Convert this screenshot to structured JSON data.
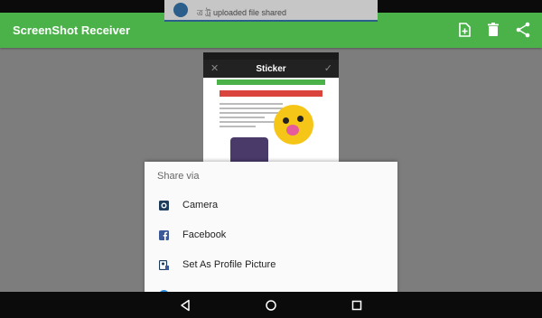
{
  "notification": {
    "text": "ত্র ট্র uploaded file shared"
  },
  "appbar": {
    "title": "ScreenShot Receiver",
    "actions": [
      "add-file-icon",
      "delete-icon",
      "share-icon"
    ]
  },
  "preview": {
    "title": "Sticker"
  },
  "share_dialog": {
    "title": "Share via",
    "items": [
      {
        "label": "Camera",
        "icon": "camera-icon"
      },
      {
        "label": "Facebook",
        "icon": "facebook-icon"
      },
      {
        "label": "Set As Profile Picture",
        "icon": "profile-picture-icon"
      },
      {
        "label": "",
        "icon": "messenger-icon"
      }
    ]
  },
  "nav": [
    "back-icon",
    "home-icon",
    "recents-icon"
  ],
  "colors": {
    "appbar": "#4bb24a",
    "dim": "#7d7d7d",
    "nav": "#0b0b0b"
  }
}
